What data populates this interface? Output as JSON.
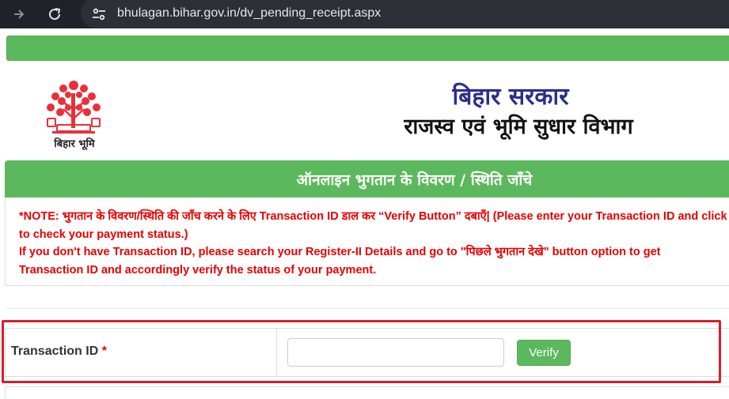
{
  "browser": {
    "url": "bhulagan.bihar.gov.in/dv_pending_receipt.aspx",
    "forward_icon": "arrow-right-icon",
    "reload_icon": "reload-icon",
    "site_info_icon": "tune-icon"
  },
  "header": {
    "logo_caption": "बिहार भूमि",
    "govt_title": "बिहार सरकार",
    "dept_title": "राजस्व एवं भूमि सुधार विभाग"
  },
  "section": {
    "title": "ऑनलाइन भुगतान के विवरण / स्थिति जाँचे"
  },
  "note": {
    "line1": "*NOTE: भुगतान के विवरण/स्थिति की जाँच करने के लिए Transaction ID डाल कर “Verify Button” दबाएँ| (Please enter your Transaction ID and click the “Verify Button”",
    "line2": "to check your payment status.)",
    "line3": "If you don't have Transaction ID, please search your Register-II Details and go to \"पिछले भुगतान देखे\" button option to get",
    "line4": "Transaction ID and accordingly verify the status of your payment."
  },
  "form": {
    "label": "Transaction ID",
    "required_mark": "*",
    "input_value": "",
    "verify_label": "Verify"
  },
  "colors": {
    "green": "#5cb85c",
    "note_red": "#e60000",
    "highlight_red": "#d61f2c",
    "govt_title_blue": "#2a2e8a"
  }
}
